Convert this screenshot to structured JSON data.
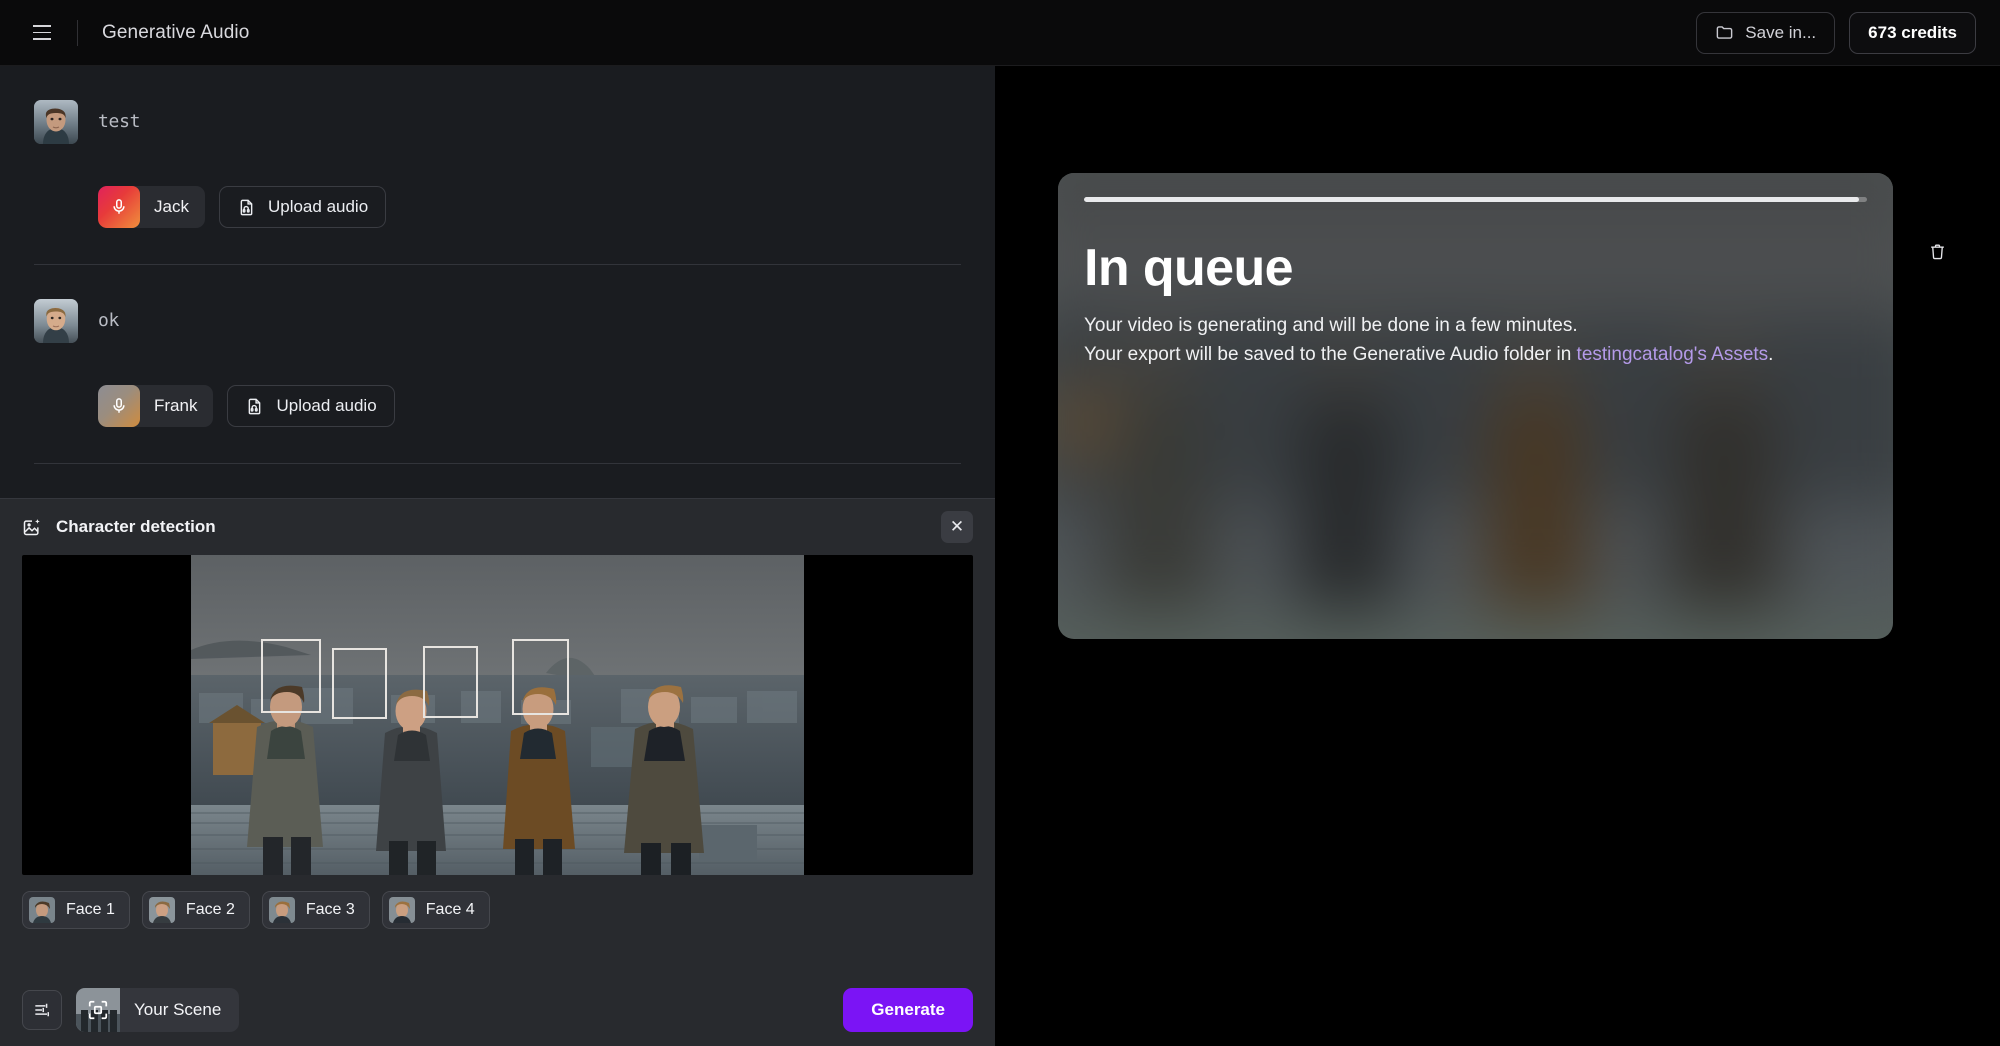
{
  "topbar": {
    "menu_icon": "hamburger-menu-icon",
    "title": "Generative Audio",
    "save_in_label": "Save in...",
    "save_in_icon": "folder-icon",
    "credits_label": "673 credits"
  },
  "script": {
    "rows": [
      {
        "avatar": "character-avatar-1",
        "text": "test",
        "voice_name": "Jack",
        "voice_icon": "microphone-icon",
        "upload_label": "Upload audio",
        "upload_icon": "audio-file-icon"
      },
      {
        "avatar": "character-avatar-2",
        "text": "ok",
        "voice_name": "Frank",
        "voice_icon": "microphone-icon",
        "upload_label": "Upload audio",
        "upload_icon": "audio-file-icon"
      }
    ]
  },
  "character_detection": {
    "title": "Character detection",
    "panel_icon": "image-sparkle-icon",
    "close_icon": "close-icon",
    "faces": [
      {
        "label": "Face 1"
      },
      {
        "label": "Face 2"
      },
      {
        "label": "Face 3"
      },
      {
        "label": "Face 4"
      }
    ]
  },
  "bottombar": {
    "settings_icon": "sliders-icon",
    "scene_label": "Your Scene",
    "scene_icon": "crop-frame-icon",
    "generate_label": "Generate"
  },
  "preview": {
    "status_title": "In queue",
    "line1": "Your video is generating and will be done in a few minutes.",
    "line2_prefix": "Your export will be saved to the Generative Audio folder in ",
    "line2_link": "testingcatalog's Assets",
    "line2_suffix": ".",
    "delete_icon": "trash-icon",
    "progress_percent": 99
  },
  "colors": {
    "accent": "#7b14f5",
    "link": "#b49ae8",
    "panel_bg": "#1a1c20",
    "detect_bg": "#282a2e",
    "page_bg": "#000000"
  }
}
